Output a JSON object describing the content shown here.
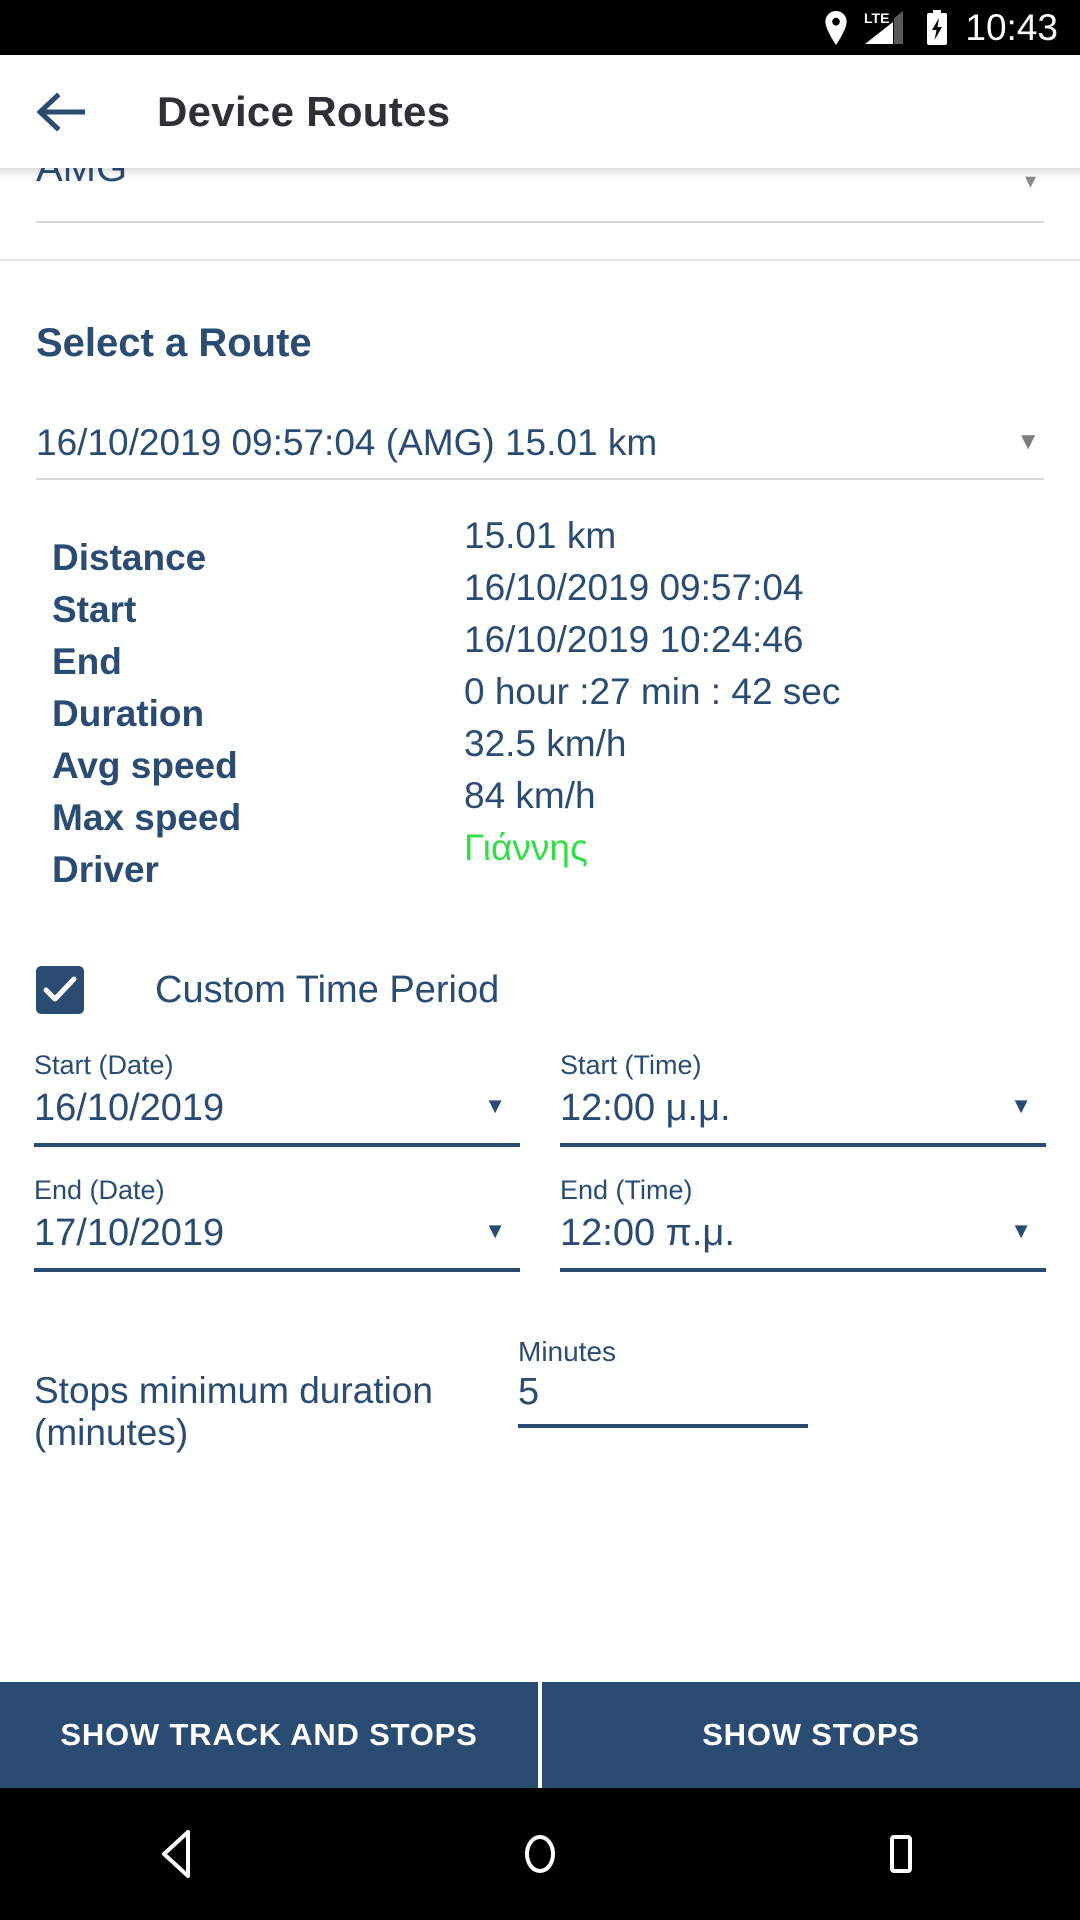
{
  "status_bar": {
    "time": "10:43",
    "icons": [
      "location-pin-icon",
      "lte-signal-icon",
      "battery-charging-icon"
    ],
    "network_label": "LTE"
  },
  "app_bar": {
    "back_icon": "back-arrow-icon",
    "title": "Device Routes"
  },
  "device_select": {
    "value": "AMG",
    "caret": "▾"
  },
  "route_section": {
    "title": "Select a Route",
    "selected_route": "16/10/2019 09:57:04 (AMG) 15.01 km",
    "caret": "▼"
  },
  "details": {
    "rows": [
      {
        "label": "Distance",
        "value": "15.01 km"
      },
      {
        "label": "Start",
        "value": "16/10/2019 09:57:04"
      },
      {
        "label": "End",
        "value": "16/10/2019 10:24:46"
      },
      {
        "label": "Duration",
        "value": "0 hour :27 min : 42 sec"
      },
      {
        "label": "Avg speed",
        "value": "32.5 km/h"
      },
      {
        "label": "Max speed",
        "value": "84 km/h"
      },
      {
        "label": "Driver",
        "value": "Γιάννης"
      }
    ]
  },
  "custom_time_period": {
    "label": "Custom Time Period",
    "checked": true,
    "check_glyph": "✔"
  },
  "date_time": {
    "start_date": {
      "caption": "Start (Date)",
      "value": "16/10/2019",
      "caret": "▼"
    },
    "start_time": {
      "caption": "Start (Time)",
      "value": "12:00 μ.μ.",
      "caret": "▼"
    },
    "end_date": {
      "caption": "End (Date)",
      "value": "17/10/2019",
      "caret": "▼"
    },
    "end_time": {
      "caption": "End (Time)",
      "value": "12:00 π.μ.",
      "caret": "▼"
    }
  },
  "stops": {
    "label": "Stops minimum duration (minutes)",
    "caption": "Minutes",
    "value": "5"
  },
  "actions": {
    "show_track_and_stops": "SHOW TRACK AND STOPS",
    "show_stops": "SHOW STOPS"
  },
  "nav_bar": {
    "back": "back-triangle-icon",
    "home": "home-circle-icon",
    "recents": "recents-square-icon"
  },
  "colors": {
    "primary_navy": "#2b4c72",
    "driver_green": "#33dd44",
    "status_bar_bg": "#000000",
    "page_bg": "#ffffff"
  }
}
